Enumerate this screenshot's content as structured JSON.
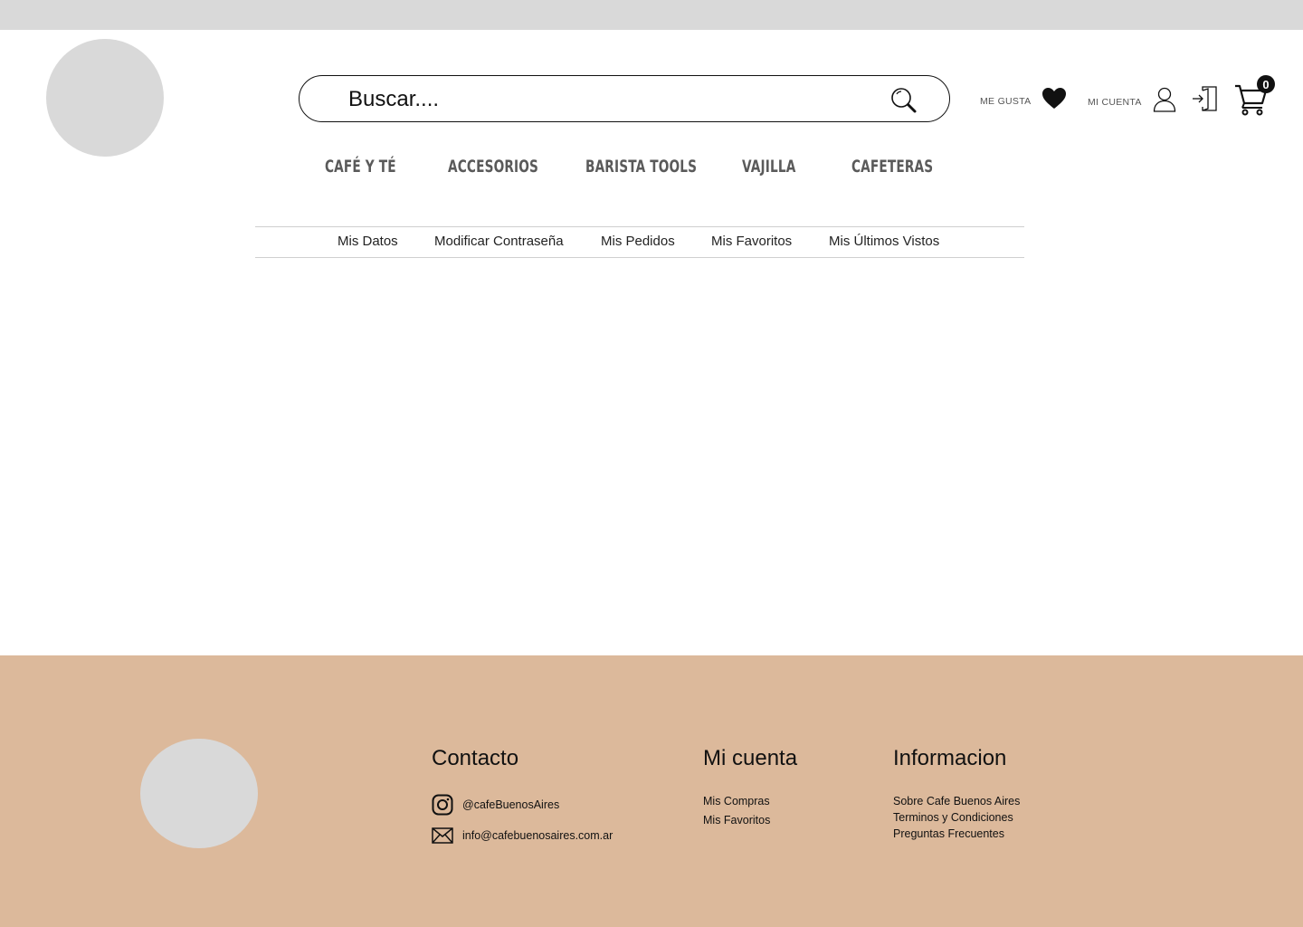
{
  "header": {
    "search": {
      "placeholder": "Buscar...."
    },
    "like_label": "ME GUSTA",
    "account_label": "MI CUENTA",
    "cart_count": "0",
    "icons": {
      "search": "search-icon",
      "like": "heart-icon",
      "account": "user-icon",
      "login": "login-icon",
      "cart": "cart-icon"
    }
  },
  "nav": {
    "categories": [
      "CAFÉ Y TÉ",
      "ACCESORIOS",
      "BARISTA TOOLS",
      "VAJILLA",
      "CAFETERAS"
    ]
  },
  "account_nav": {
    "items": [
      "Mis Datos",
      "Modificar Contraseña",
      "Mis Pedidos",
      "Mis Favoritos",
      "Mis Últimos Vistos"
    ]
  },
  "footer": {
    "contact": {
      "title": "Contacto",
      "instagram": "@cafeBuenosAires",
      "email": "info@cafebuenosaires.com.ar"
    },
    "account": {
      "title": "Mi cuenta",
      "links": [
        "Mis Compras",
        "Mis Favoritos"
      ]
    },
    "info": {
      "title": "Informacion",
      "links": [
        "Sobre Cafe Buenos Aires",
        "Terminos y Condiciones",
        "Preguntas Frecuentes"
      ]
    },
    "background_color": "#dcb99b"
  }
}
